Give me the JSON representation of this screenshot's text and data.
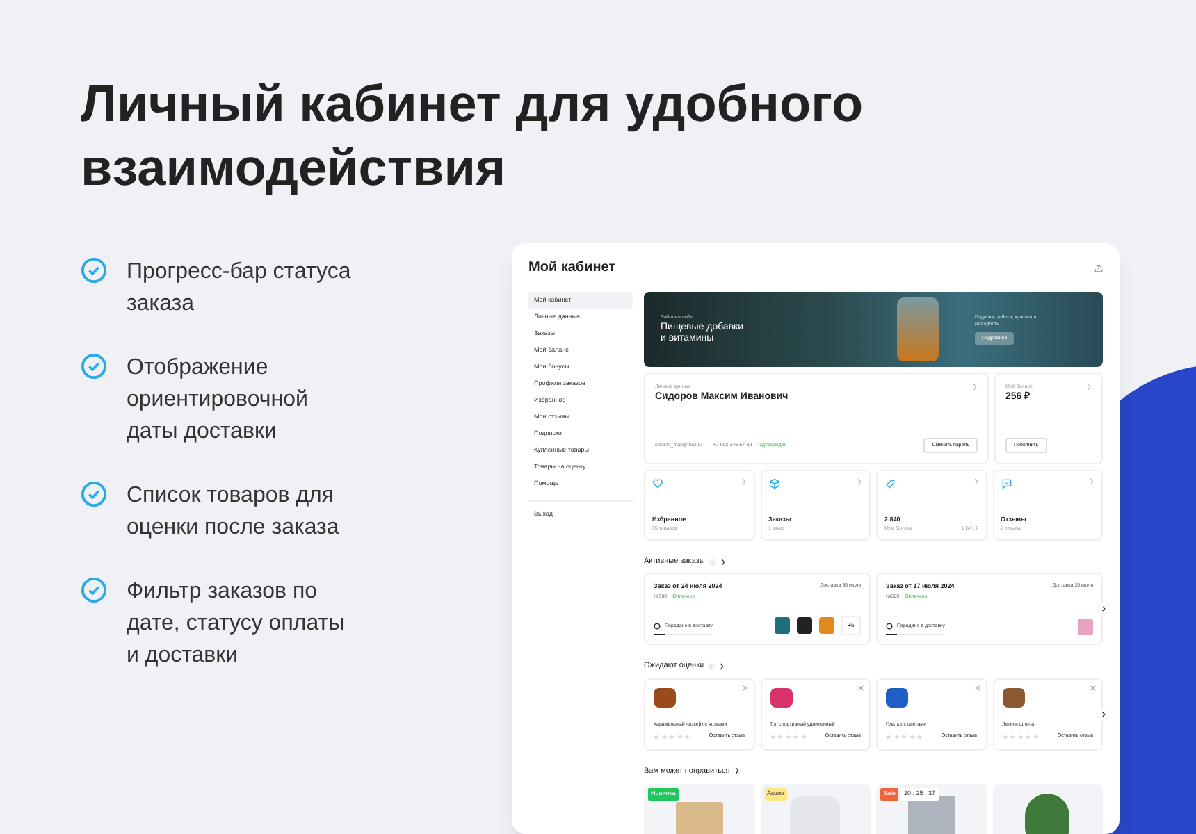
{
  "headline": "Личный кабинет для удобного взаимодействия",
  "features": [
    "Прогресс-бар статуса заказа",
    "Отображение ориентировочной даты доставки",
    "Список товаров для оценки после заказа",
    "Фильтр заказов по дате, статусу оплаты и доставки"
  ],
  "cabinet": {
    "title": "Мой кабинет",
    "sidebar": {
      "items": [
        {
          "label": "Мой кабинет",
          "selected": true
        },
        {
          "label": "Личные данные",
          "selected": false
        },
        {
          "label": "Заказы",
          "selected": false
        },
        {
          "label": "Мой баланс",
          "selected": false
        },
        {
          "label": "Мои бонусы",
          "selected": false
        },
        {
          "label": "Профили заказов",
          "selected": false
        },
        {
          "label": "Избранное",
          "selected": false
        },
        {
          "label": "Мои отзывы",
          "selected": false
        },
        {
          "label": "Подписки",
          "selected": false
        },
        {
          "label": "Купленные товары",
          "selected": false
        },
        {
          "label": "Товары на оценку",
          "selected": false
        },
        {
          "label": "Помощь",
          "selected": false
        }
      ],
      "logout": "Выход"
    },
    "banner": {
      "eyebrow": "Забота о себе",
      "title": "Пищевые добавки и витамины",
      "note": "Подарки, забота, красота и молодость",
      "button": "Подробнее"
    },
    "profile": {
      "caption": "Личные данные",
      "name": "Сидоров Максим Иванович",
      "email": "sidorov_max@mail.ru",
      "phone": "+7 902 345-67-89",
      "phone_status": "Подтвержден",
      "button": "Сменить пароль"
    },
    "balance": {
      "caption": "Мой баланс",
      "amount": "256 ₽",
      "button": "Пополнить"
    },
    "stats": [
      {
        "kind": "heart",
        "title": "Избранное",
        "sub": "35 товаров"
      },
      {
        "kind": "box",
        "title": "Заказы",
        "sub": "1 заказ"
      },
      {
        "kind": "tag",
        "title": "2 840",
        "sub": "Мои бонусы",
        "extra": "1 Б=1 ₽"
      },
      {
        "kind": "chat",
        "title": "Отзывы",
        "sub": "2 отзыва"
      }
    ],
    "orders": {
      "heading": "Активные заказы",
      "items": [
        {
          "title": "Заказ от 24 июля 2024",
          "delivery": "Доставка 30 июля",
          "number": "№500",
          "payment": "Оплачено",
          "status": "Передано в доставку",
          "level": 0.2,
          "thumbs": [
            {
              "color": "#1f6f7a"
            },
            {
              "color": "#222222"
            },
            {
              "color": "#e08a1e"
            }
          ],
          "more": "+5"
        },
        {
          "title": "Заказ от 17 июля 2024",
          "delivery": "Доставка 20 июля",
          "number": "№500",
          "payment": "Оплачено",
          "status": "Передано в доставку",
          "level": 0.2,
          "thumbs": [
            {
              "color": "#e8a3c4"
            }
          ]
        }
      ]
    },
    "reviews": {
      "heading": "Ожидают оценки",
      "items": [
        {
          "name": "Карамельный чизкейк с ягодами",
          "stars": 0,
          "action": "Оставить отзыв",
          "color": "#9a4b1c"
        },
        {
          "name": "Топ спортивный удлиненный",
          "stars": 0,
          "action": "Оставить отзыв",
          "color": "#d6336c"
        },
        {
          "name": "Платье с цветами",
          "stars": 0,
          "action": "Оставить отзыв",
          "color": "#1d5fc4"
        },
        {
          "name": "Летняя шляпа",
          "stars": 0,
          "action": "Оставить отзыв",
          "color": "#8b5a33"
        }
      ]
    },
    "recommended": {
      "heading": "Вам может понравиться",
      "items": [
        {
          "kind": "nightstand",
          "badge": "Новинка",
          "color": "#22c55e"
        },
        {
          "kind": "vase",
          "badge": "Акция",
          "color": "#fde68a"
        },
        {
          "kind": "rug",
          "badge": "Sale",
          "color": "#f0643c",
          "timer": "20 : 25 : 37"
        },
        {
          "kind": "plant"
        }
      ]
    }
  }
}
